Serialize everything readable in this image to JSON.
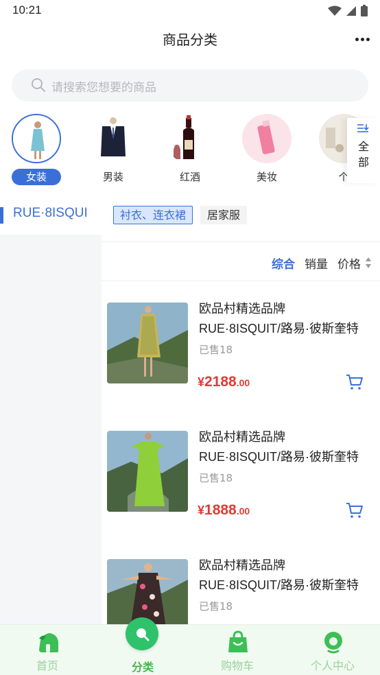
{
  "status_bar": {
    "time": "10:21"
  },
  "header": {
    "title": "商品分类"
  },
  "search": {
    "placeholder": "请搜索您想要的商品"
  },
  "categories": {
    "items": [
      {
        "label": "女装",
        "active": true
      },
      {
        "label": "男装",
        "active": false
      },
      {
        "label": "红酒",
        "active": false
      },
      {
        "label": "美妆",
        "active": false
      },
      {
        "label": "个",
        "active": false
      }
    ],
    "all_label": "全部"
  },
  "brands": {
    "active": "RUE·8ISQUI"
  },
  "subtabs": [
    {
      "label": "衬衣、连衣裙",
      "active": true
    },
    {
      "label": "居家服",
      "active": false
    }
  ],
  "sort": {
    "comprehensive": "综合",
    "sales": "销量",
    "price": "价格"
  },
  "products": [
    {
      "shop": "欧品村精选品牌",
      "name": "RUE·8ISQUIT/路易·彼斯奎特",
      "sold": "已售18",
      "price_symbol": "¥",
      "price_int": "2188",
      "price_dec": ".00"
    },
    {
      "shop": "欧品村精选品牌",
      "name": "RUE·8ISQUIT/路易·彼斯奎特",
      "sold": "已售18",
      "price_symbol": "¥",
      "price_int": "1888",
      "price_dec": ".00"
    },
    {
      "shop": "欧品村精选品牌",
      "name": "RUE·8ISQUIT/路易·彼斯奎特",
      "sold": "已售18"
    }
  ],
  "tabbar": [
    {
      "label": "首页",
      "active": false
    },
    {
      "label": "分类",
      "active": true
    },
    {
      "label": "购物车",
      "active": false
    },
    {
      "label": "个人中心",
      "active": false
    }
  ],
  "colors": {
    "accent": "#3b6fd8",
    "price": "#e53935",
    "tab_active": "#43b649",
    "tab_inactive": "#9ad19a"
  }
}
